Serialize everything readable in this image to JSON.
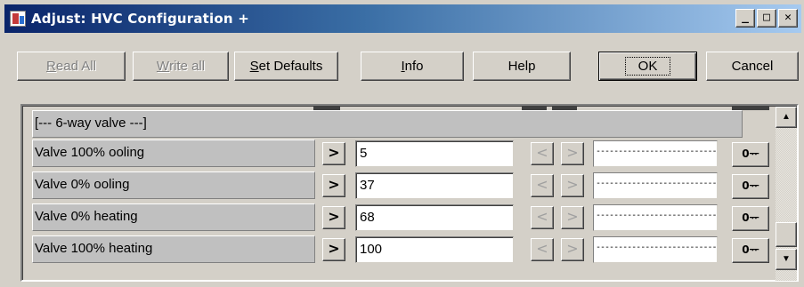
{
  "window": {
    "title": "Adjust: HVC Configuration +",
    "minimize_glyph": "_",
    "maximize_glyph": "□",
    "close_glyph": "✕"
  },
  "toolbar": {
    "read_all": {
      "mnemonic": "R",
      "rest": "ead All",
      "enabled": false
    },
    "write_all": {
      "mnemonic": "W",
      "rest": "rite all",
      "enabled": false
    },
    "set_defaults": {
      "mnemonic": "S",
      "rest": "et Defaults",
      "enabled": true
    },
    "info": {
      "mnemonic": "I",
      "rest": "nfo",
      "enabled": true
    },
    "help": {
      "label": "Help",
      "enabled": true
    },
    "ok": {
      "label": "OK",
      "enabled": true,
      "is_default": true
    },
    "cancel": {
      "label": "Cancel",
      "enabled": true
    }
  },
  "section": {
    "header": "[--- 6-way valve ---]"
  },
  "rows": [
    {
      "label": "Valve 100% ooling",
      "value": "5",
      "readback": "------------------------------",
      "key_glyph": "0ᅲ"
    },
    {
      "label": "Valve 0% ooling",
      "value": "37",
      "readback": "------------------------------",
      "key_glyph": "0ᅲ"
    },
    {
      "label": "Valve 0% heating",
      "value": "68",
      "readback": "------------------------------",
      "key_glyph": "0ᅲ"
    },
    {
      "label": "Valve 100% heating",
      "value": "100",
      "readback": "------------------------------",
      "key_glyph": "0ᅲ"
    }
  ],
  "glyphs": {
    "send": ">",
    "decrement": "<",
    "increment": ">",
    "scroll_up": "▲",
    "scroll_down": "▼"
  }
}
